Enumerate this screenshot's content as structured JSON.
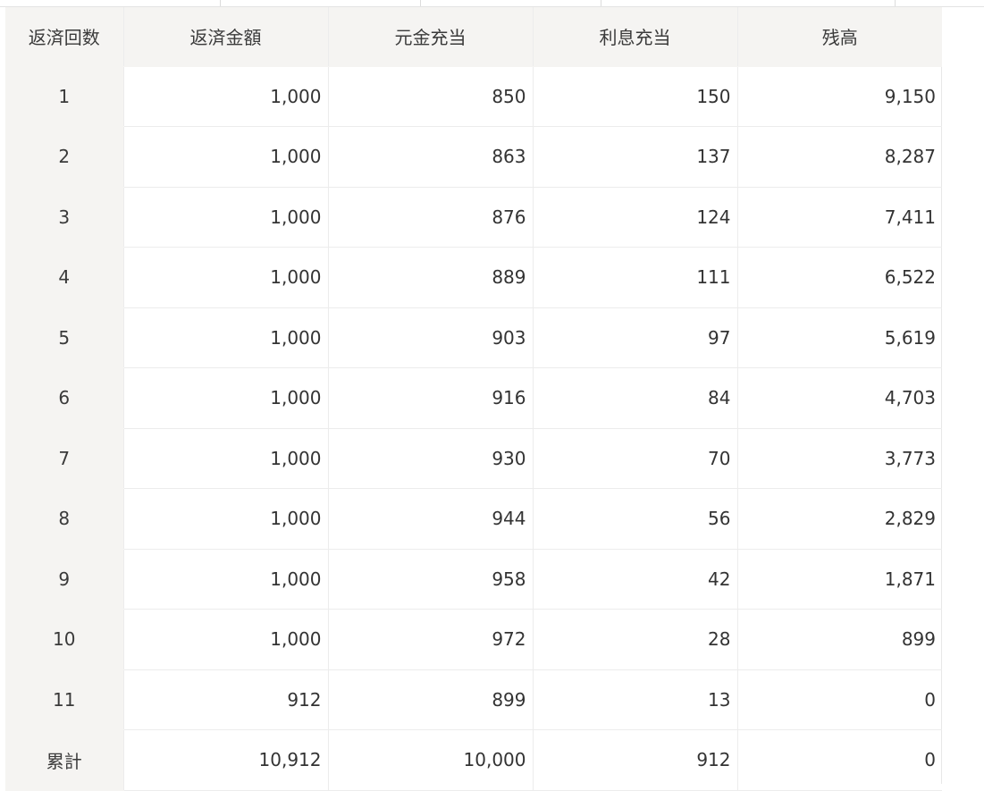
{
  "table": {
    "headers": [
      "返済回数",
      "返済金額",
      "元金充当",
      "利息充当",
      "残高"
    ],
    "rows": [
      [
        "1",
        "1,000",
        "850",
        "150",
        "9,150"
      ],
      [
        "2",
        "1,000",
        "863",
        "137",
        "8,287"
      ],
      [
        "3",
        "1,000",
        "876",
        "124",
        "7,411"
      ],
      [
        "4",
        "1,000",
        "889",
        "111",
        "6,522"
      ],
      [
        "5",
        "1,000",
        "903",
        "97",
        "5,619"
      ],
      [
        "6",
        "1,000",
        "916",
        "84",
        "4,703"
      ],
      [
        "7",
        "1,000",
        "930",
        "70",
        "3,773"
      ],
      [
        "8",
        "1,000",
        "944",
        "56",
        "2,829"
      ],
      [
        "9",
        "1,000",
        "958",
        "42",
        "1,871"
      ],
      [
        "10",
        "1,000",
        "972",
        "28",
        "899"
      ],
      [
        "11",
        "912",
        "899",
        "13",
        "0"
      ],
      [
        "累計",
        "10,912",
        "10,000",
        "912",
        "0"
      ]
    ]
  },
  "colors": {
    "header_bg": "#f5f4f2",
    "grid_line": "#ececec",
    "text": "#333333"
  }
}
